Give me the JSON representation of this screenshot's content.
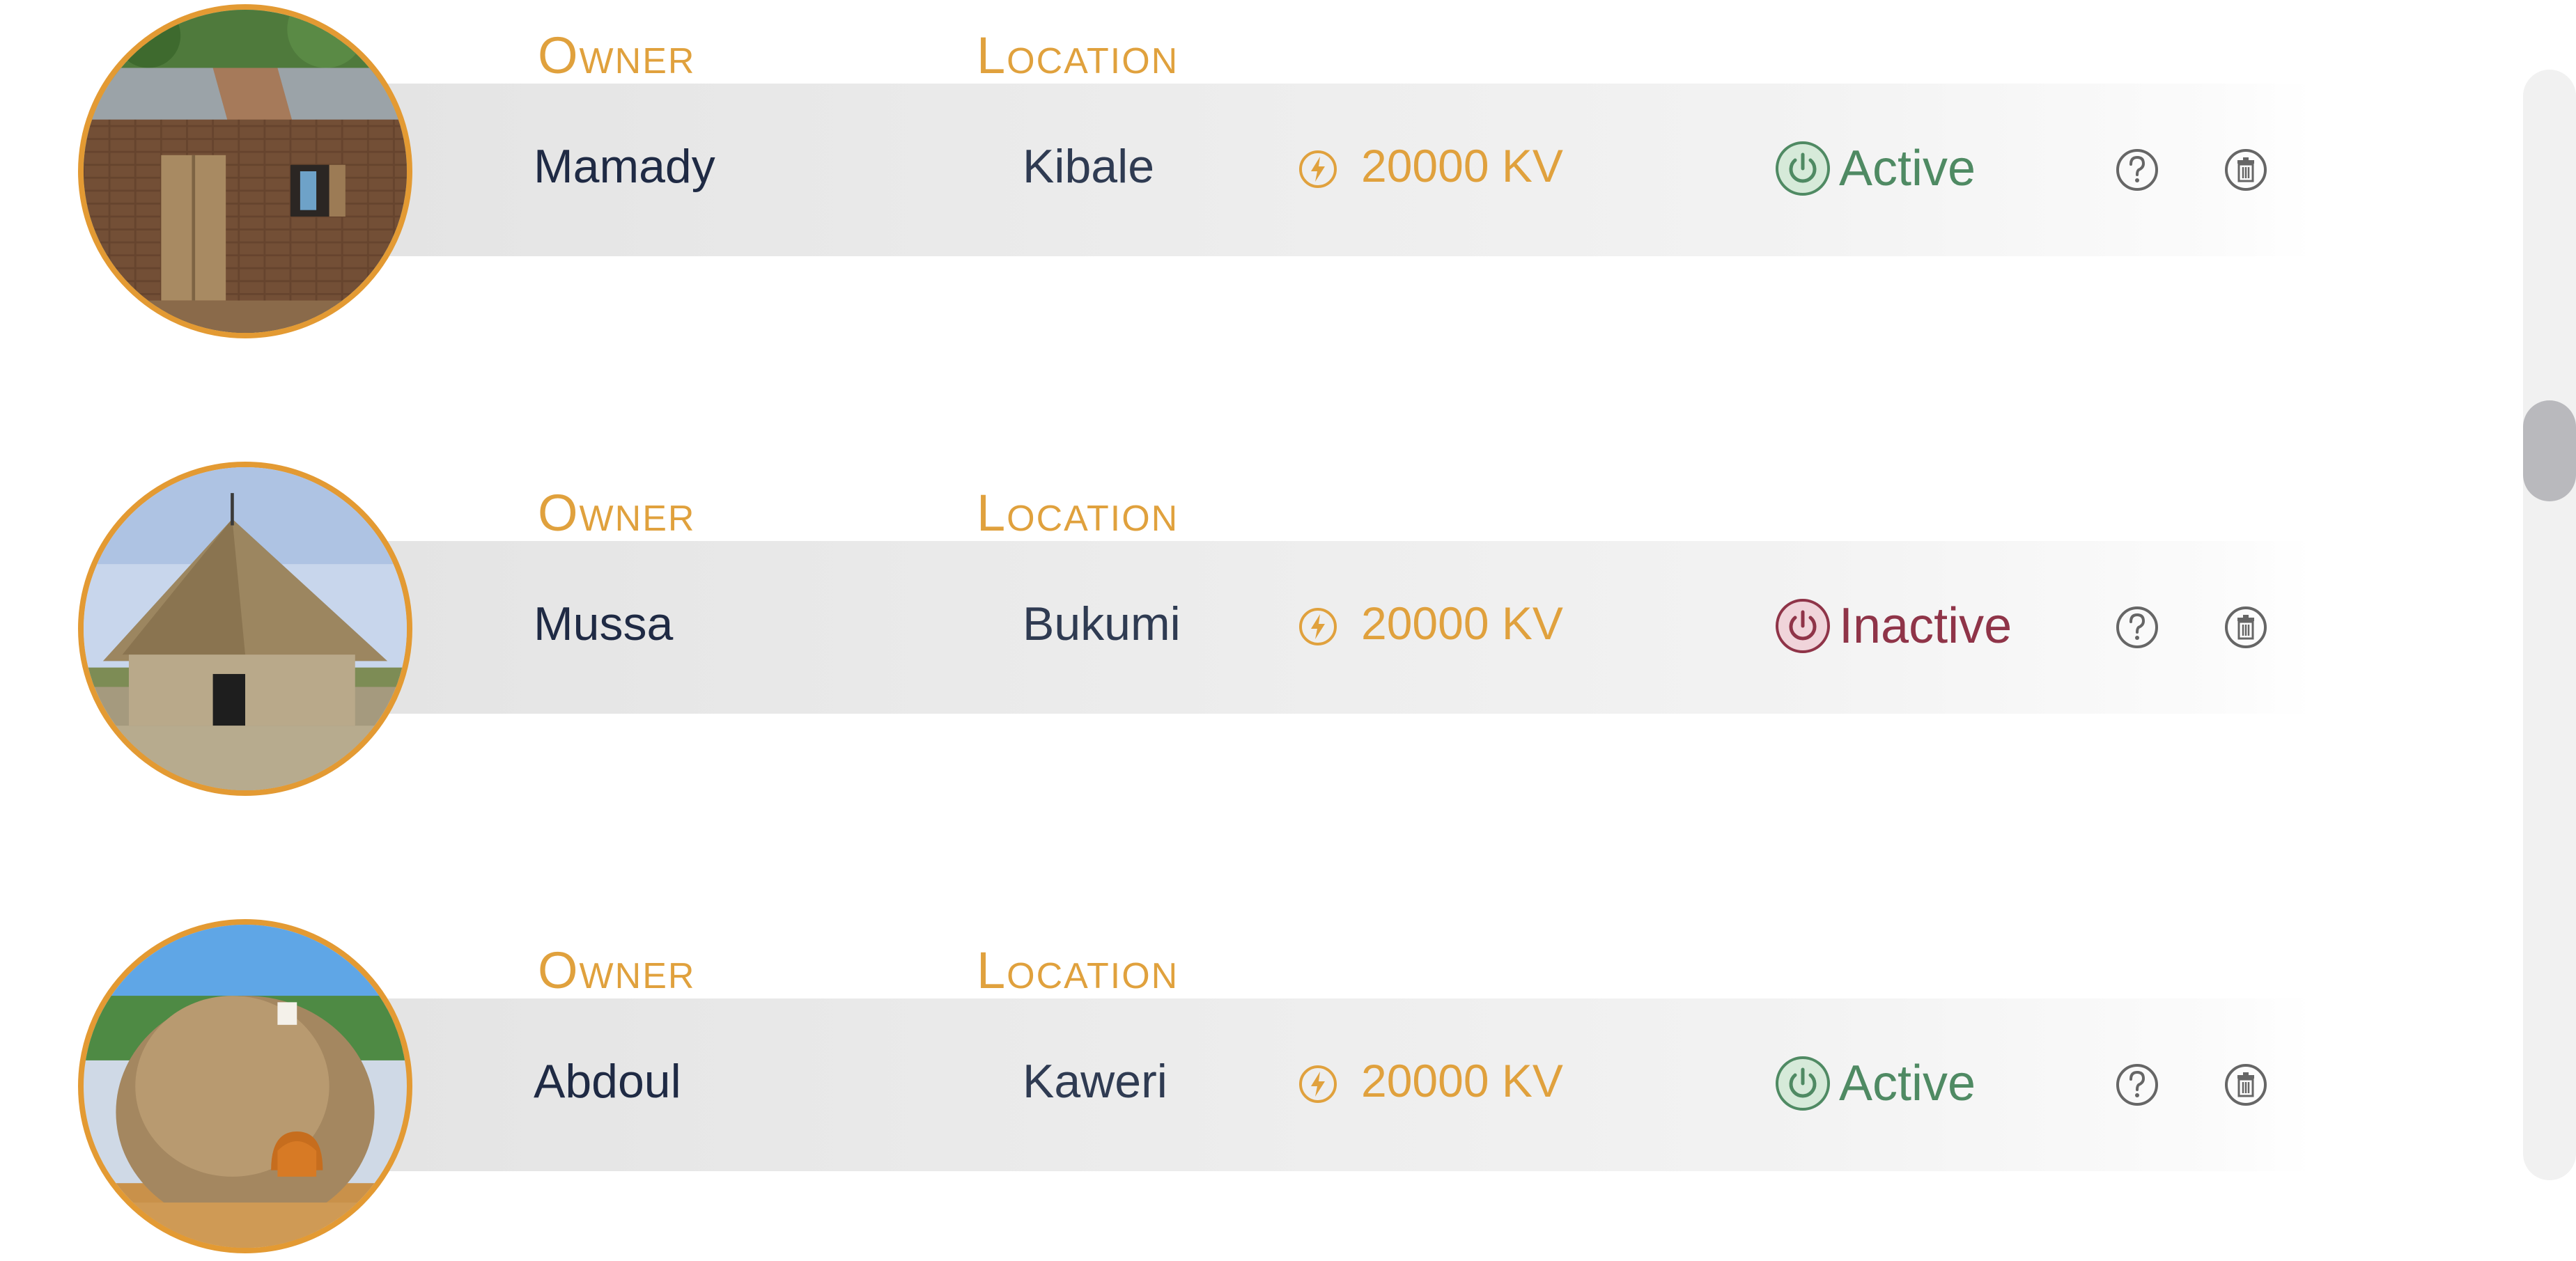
{
  "columns": {
    "owner_label": "Owner",
    "location_label": "Location"
  },
  "colors": {
    "accent": "#e0a13d",
    "active": "#4f8a63",
    "active_bg": "#d6ead9",
    "inactive": "#8f3448",
    "inactive_bg": "#f0d4da",
    "name_text": "#1f2a44",
    "ring": "#e39a33",
    "icon_gray": "#666666"
  },
  "houses": [
    {
      "owner": "Mamady",
      "location": "Kibale",
      "power": "20000 KV",
      "status": "Active",
      "status_kind": "active",
      "image": "brick-house-with-tin-roof"
    },
    {
      "owner": "Mussa",
      "location": "Bukumi",
      "power": "20000 KV",
      "status": "Inactive",
      "status_kind": "inactive",
      "image": "round-hut-with-thatched-roof"
    },
    {
      "owner": "Abdoul",
      "location": "Kaweri",
      "power": "20000 KV",
      "status": "Active",
      "status_kind": "active",
      "image": "domed-grass-hut"
    }
  ],
  "icons": {
    "power": "lightning-circle-icon",
    "status": "power-icon",
    "help": "question-circle-icon",
    "delete": "trash-icon"
  }
}
